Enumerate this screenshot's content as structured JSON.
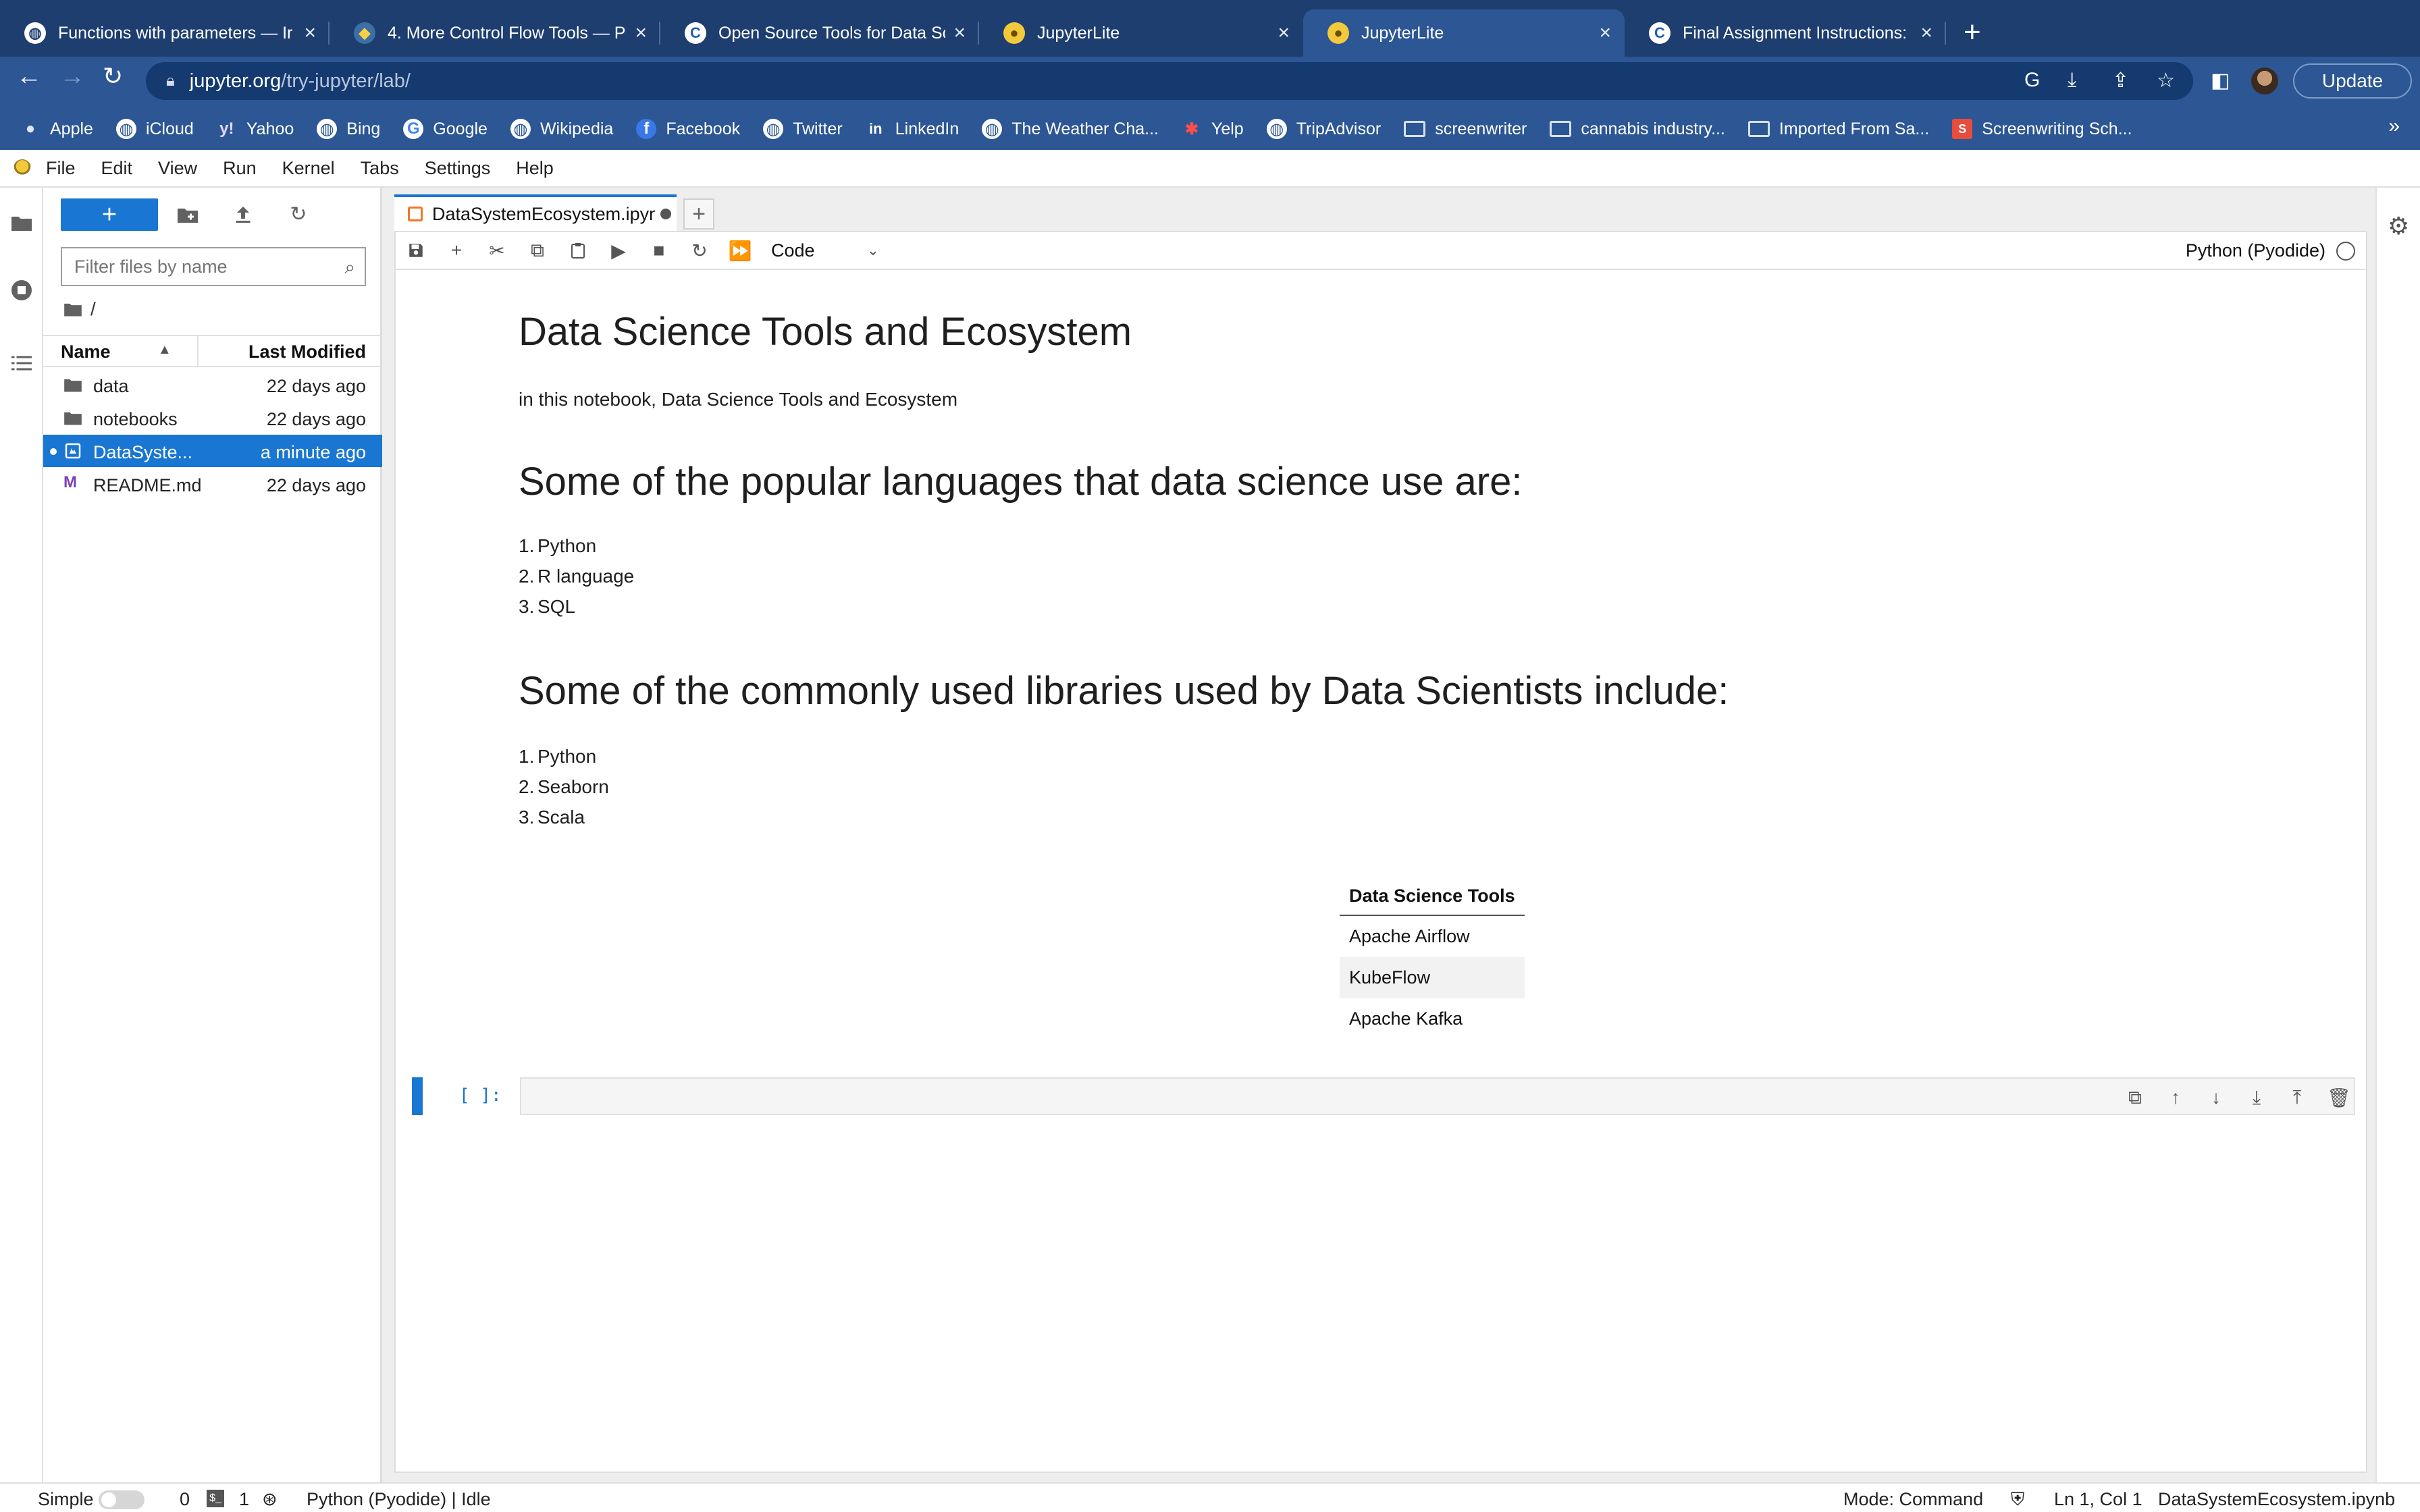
{
  "browser": {
    "tabs": [
      {
        "title": "Functions with parameters — Ir",
        "icon": "globe-icon",
        "active": false
      },
      {
        "title": "4. More Control Flow Tools — P",
        "icon": "python-icon",
        "active": false
      },
      {
        "title": "Open Source Tools for Data Sc",
        "icon": "coursera-icon",
        "active": false
      },
      {
        "title": "JupyterLite",
        "icon": "jupyter-icon",
        "active": false
      },
      {
        "title": "JupyterLite",
        "icon": "jupyter-icon",
        "active": true
      },
      {
        "title": "Final Assignment Instructions:",
        "icon": "coursera-icon",
        "active": false
      }
    ],
    "url_host": "jupyter.org",
    "url_path": "/try-jupyter/lab/",
    "update_label": "Update",
    "bookmarks": [
      {
        "label": "Apple",
        "icon": "apple-icon"
      },
      {
        "label": "iCloud",
        "icon": "globe-icon"
      },
      {
        "label": "Yahoo",
        "icon": "yahoo-icon"
      },
      {
        "label": "Bing",
        "icon": "globe-icon"
      },
      {
        "label": "Google",
        "icon": "google-icon"
      },
      {
        "label": "Wikipedia",
        "icon": "globe-icon"
      },
      {
        "label": "Facebook",
        "icon": "facebook-icon"
      },
      {
        "label": "Twitter",
        "icon": "globe-icon"
      },
      {
        "label": "LinkedIn",
        "icon": "linkedin-icon"
      },
      {
        "label": "The Weather Cha...",
        "icon": "globe-icon"
      },
      {
        "label": "Yelp",
        "icon": "yelp-icon"
      },
      {
        "label": "TripAdvisor",
        "icon": "globe-icon"
      },
      {
        "label": "screenwriter",
        "icon": "folder-icon"
      },
      {
        "label": "cannabis industry...",
        "icon": "folder-icon"
      },
      {
        "label": "Imported From Sa...",
        "icon": "folder-icon"
      },
      {
        "label": "Screenwriting Sch...",
        "icon": "bookmark-red-icon"
      }
    ],
    "bookmarks_more": "»"
  },
  "menu": [
    "File",
    "Edit",
    "View",
    "Run",
    "Kernel",
    "Tabs",
    "Settings",
    "Help"
  ],
  "filebrowser": {
    "new_label": "+",
    "filter_placeholder": "Filter files by name",
    "breadcrumb": "/",
    "col_name": "Name",
    "col_modified": "Last Modified",
    "files": [
      {
        "name": "data",
        "modified": "22 days ago",
        "type": "folder"
      },
      {
        "name": "notebooks",
        "modified": "22 days ago",
        "type": "folder"
      },
      {
        "name": "DataSyste...",
        "modified": "a minute ago",
        "type": "notebook",
        "selected": true
      },
      {
        "name": "README.md",
        "modified": "22 days ago",
        "type": "markdown"
      }
    ]
  },
  "notebook": {
    "tab_name": "DataSystemEcosystem.ipynb",
    "add_tab": "+",
    "cell_type": "Code",
    "kernel": "Python (Pyodide)",
    "title": "Data Science Tools and Ecosystem",
    "intro": "in this notebook, Data Science Tools and Ecosystem",
    "languages_heading": "Some of the popular languages that data science use are:",
    "languages": [
      "Python",
      "R language",
      "SQL"
    ],
    "libraries_heading": "Some of the commonly used libraries used by Data Scientists include:",
    "libraries": [
      "Python",
      "Seaborn",
      "Scala"
    ],
    "table_header": "Data Science Tools",
    "table_rows": [
      "Apache Airflow",
      "KubeFlow",
      "Apache Kafka"
    ],
    "cell_prompt": "[ ]:"
  },
  "statusbar": {
    "mode_label": "Simple",
    "terminals": "0",
    "kernels": "1",
    "kernel_status": "Python (Pyodide) | Idle",
    "mode": "Mode: Command",
    "position": "Ln 1, Col 1",
    "filename": "DataSystemEcosystem.ipynb"
  }
}
